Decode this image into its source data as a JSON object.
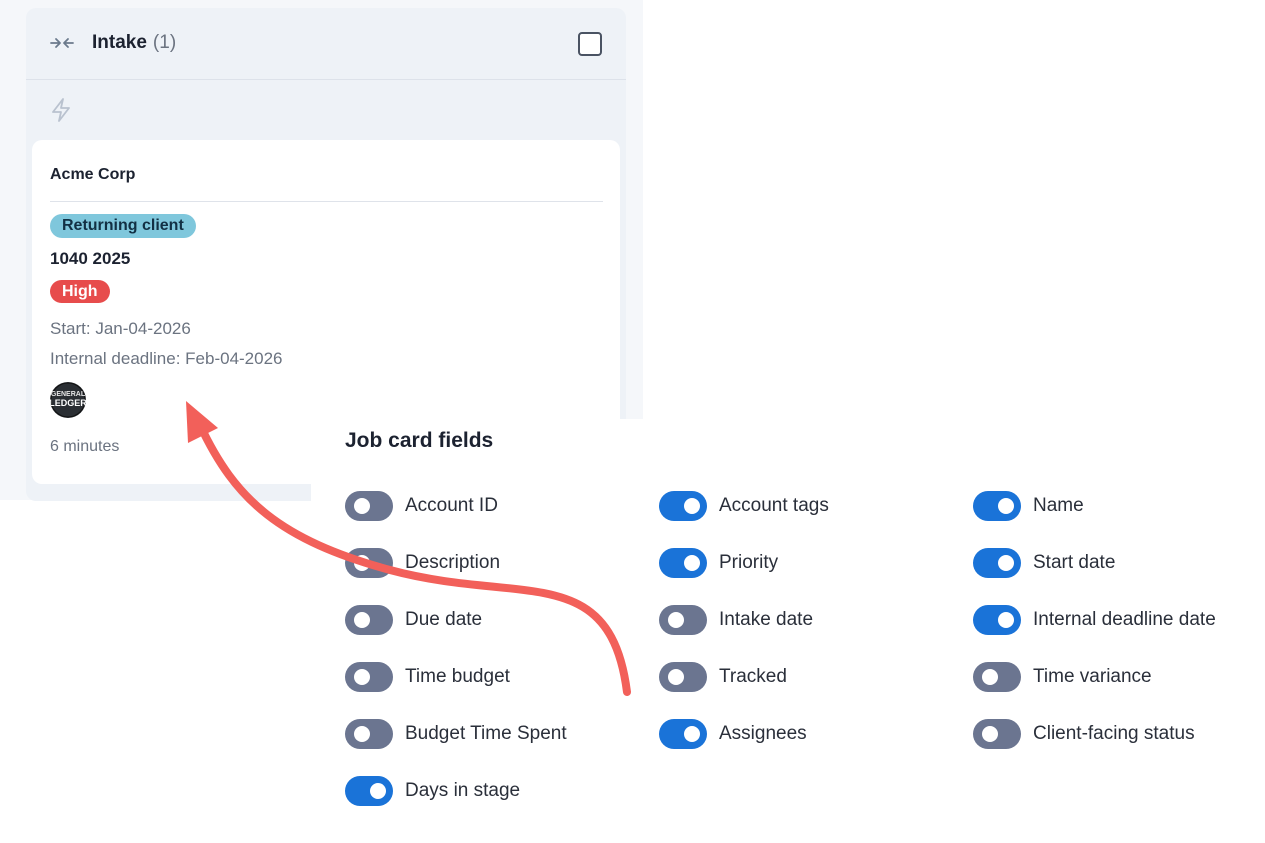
{
  "column": {
    "title": "Intake",
    "count": "(1)"
  },
  "card": {
    "account": "Acme Corp",
    "tag": "Returning client",
    "name": "1040 2025",
    "priority": "High",
    "start": "Start: Jan-04-2026",
    "internal_deadline": "Internal deadline: Feb-04-2026",
    "avatar_text": [
      "GENERAL",
      "LEDGER"
    ],
    "days_in_stage": "6 minutes"
  },
  "panel": {
    "title": "Job card fields",
    "fields": [
      {
        "label": "Account ID",
        "on": false
      },
      {
        "label": "Account tags",
        "on": true
      },
      {
        "label": "Name",
        "on": true
      },
      {
        "label": "Description",
        "on": false
      },
      {
        "label": "Priority",
        "on": true
      },
      {
        "label": "Start date",
        "on": true
      },
      {
        "label": "Due date",
        "on": false
      },
      {
        "label": "Intake date",
        "on": false
      },
      {
        "label": "Internal deadline date",
        "on": true
      },
      {
        "label": "Time budget",
        "on": false
      },
      {
        "label": "Tracked",
        "on": false
      },
      {
        "label": "Time variance",
        "on": false
      },
      {
        "label": "Budget Time Spent",
        "on": false
      },
      {
        "label": "Assignees",
        "on": true
      },
      {
        "label": "Client-facing status",
        "on": false
      },
      {
        "label": "Days in stage",
        "on": true
      }
    ]
  },
  "colors": {
    "toggle_on": "#1a73d8",
    "toggle_off": "#6b7590",
    "tag": "#7fc7dc",
    "priority_high": "#e74c4c",
    "arrow": "#f2605a"
  }
}
